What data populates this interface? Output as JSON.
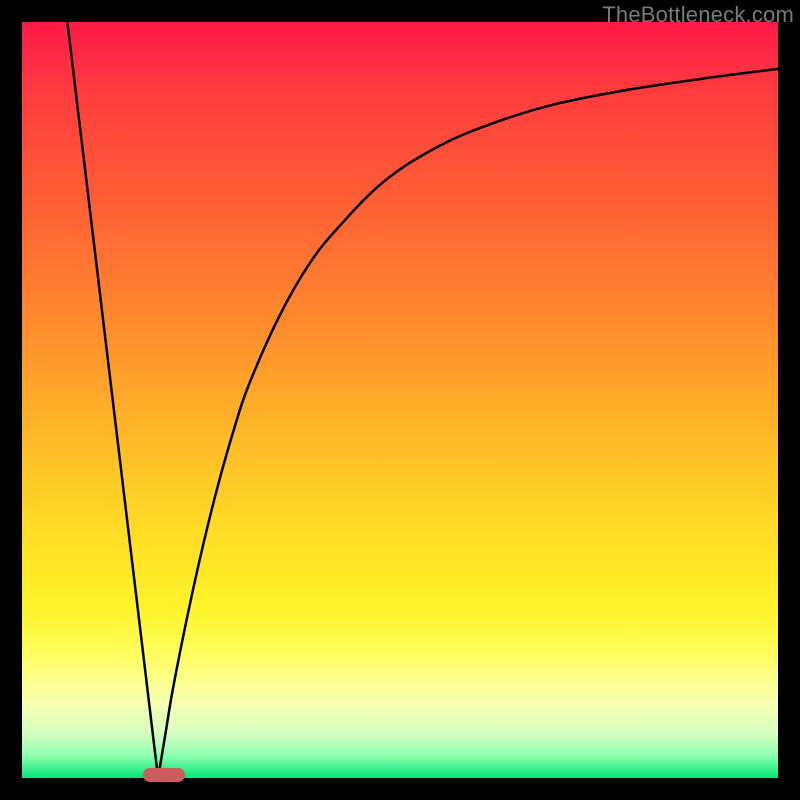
{
  "watermark": "TheBottleneck.com",
  "colors": {
    "border": "#000000",
    "curve": "#000000",
    "marker": "#cd5c5c",
    "gradient_top": "#ff1a48",
    "gradient_bottom": "#00e676"
  },
  "chart_data": {
    "type": "line",
    "title": "",
    "xlabel": "",
    "ylabel": "",
    "xlim": [
      0,
      100
    ],
    "ylim": [
      0,
      100
    ],
    "grid": false,
    "series": [
      {
        "name": "left-slope",
        "x": [
          6,
          18
        ],
        "y": [
          100,
          0
        ]
      },
      {
        "name": "right-curve",
        "x": [
          18,
          19,
          20,
          22,
          24,
          26,
          28,
          30,
          34,
          38,
          42,
          48,
          55,
          62,
          70,
          80,
          90,
          100
        ],
        "y": [
          0,
          6,
          12,
          22,
          31,
          39,
          46,
          52,
          61,
          68,
          73,
          79,
          83.5,
          86.5,
          89,
          91,
          92.5,
          93.8
        ]
      }
    ],
    "annotations": [
      {
        "name": "minimum-marker",
        "x_start": 16.0,
        "x_end": 21.5,
        "y": 0
      }
    ]
  }
}
